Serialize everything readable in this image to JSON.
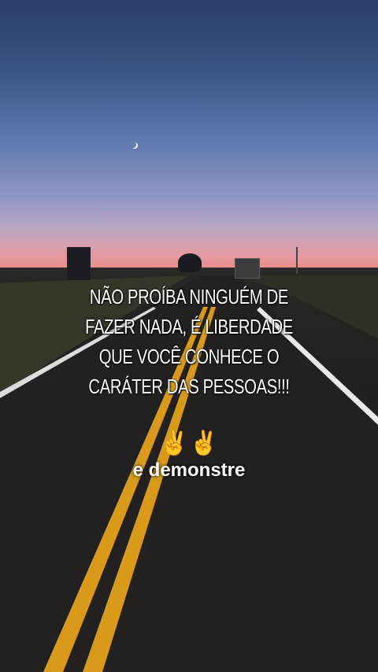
{
  "caption": {
    "lines": [
      "NÃO PROÍBA NINGUÉM DE",
      "FAZER NADA, É LIBERDADE",
      "QUE VOCÊ CONHECE O",
      "CARÁTER DAS PESSOAS!!!"
    ]
  },
  "emojis": "✌️✌️",
  "subcaption": "e demonstre",
  "colors": {
    "sky_top": "#2a3f68",
    "horizon": "#f07f6e",
    "road": "#1e1c1b",
    "center_line": "#e0a820",
    "edge_line": "#e8e8e8"
  }
}
